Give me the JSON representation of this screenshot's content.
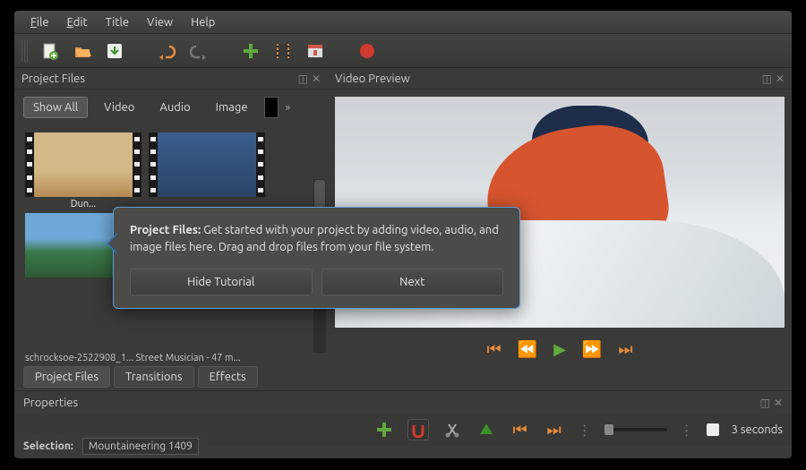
{
  "menu": {
    "file": "File",
    "edit": "Edit",
    "title": "Title",
    "view": "View",
    "help": "Help"
  },
  "panels": {
    "project_files": "Project Files",
    "video_preview": "Video Preview",
    "properties": "Properties",
    "selection_label": "Selection:",
    "selection_value": "Mountaineering   1409"
  },
  "filters": {
    "show_all": "Show All",
    "video": "Video",
    "audio": "Audio",
    "image": "Image"
  },
  "thumbs": {
    "t1_caption": "Dun...",
    "file_row": "schrocksoe-2522908_1...  Street Musician - 47 m..."
  },
  "tabs": {
    "project_files": "Project Files",
    "transitions": "Transitions",
    "effects": "Effects"
  },
  "tutorial": {
    "bold": "Project Files:",
    "body": " Get started with your project by adding video, audio, and image files here. Drag and drop files from your file system.",
    "hide": "Hide Tutorial",
    "next": "Next"
  },
  "bottom": {
    "time_label": "3 seconds"
  }
}
